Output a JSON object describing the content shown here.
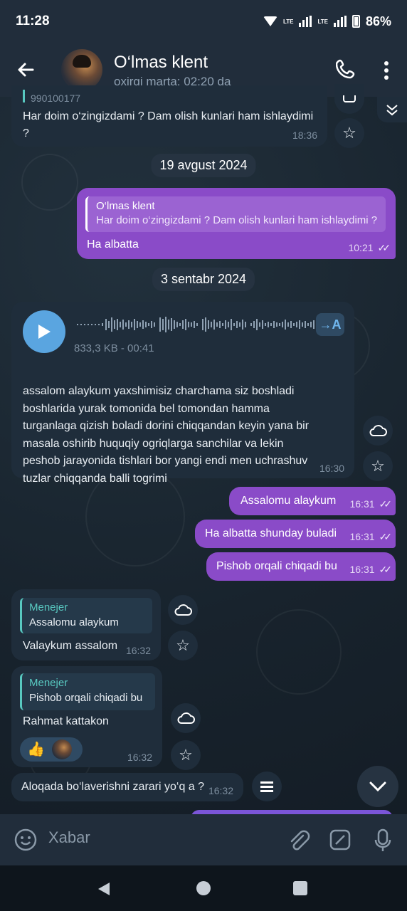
{
  "status": {
    "time": "11:28",
    "battery": "86%",
    "net1": "LTE",
    "net2": "LTE"
  },
  "header": {
    "contact_name": "O‘lmas klent",
    "last_seen": "oxirgi marta: 02:20 da"
  },
  "messages": {
    "m1": {
      "reply_top": "990100177",
      "text": "Har doim o‘zingizdami ? Dam olish kunlari ham ishlaydimi ?",
      "time": "18:36"
    },
    "date1": "19 avgust 2024",
    "m2": {
      "reply_name": "O‘lmas klent",
      "reply_text": "Har doim o‘zingizdami ? Dam olish kunlari ham ishlaydimi ?",
      "text": "Ha albatta",
      "time": "10:21"
    },
    "date2": "3 sentabr 2024",
    "m3": {
      "voice_meta": "833,3 KB - 00:41",
      "transcribe": "→A",
      "text": "assalom alaykum yaxshimisiz charchama siz boshladi boshlarida yurak tomonida bel tomondan hamma turganlaga qizish boladi dorini chiqqandan keyin yana bir masala oshirib huquqiy ogriqlarga sanchilar va lekin peshob jarayonida tishlari bor yangi endi men uchrashuv tuzlar chiqqanda balli togrimi",
      "time": "16:30"
    },
    "m4": {
      "text": "Assalomu alaykum",
      "time": "16:31"
    },
    "m5": {
      "text": "Ha albatta shunday buladi",
      "time": "16:31"
    },
    "m6": {
      "text": "Pishob orqali chiqadi bu",
      "time": "16:31"
    },
    "m7": {
      "reply_name": "Menejer",
      "reply_text": "Assalomu alaykum",
      "text": "Valaykum assalom",
      "time": "16:32"
    },
    "m8": {
      "reply_name": "Menejer",
      "reply_text": "Pishob orqali chiqadi bu",
      "text": "Rahmat kattakon",
      "reaction": "👍",
      "time": "16:32"
    },
    "m9": {
      "text": "Aloqada bo‘laverishni zarari yo‘q a ?",
      "time": "16:32"
    }
  },
  "input": {
    "placeholder": "Xabar"
  },
  "colors": {
    "header": "#212d3b",
    "outgoing": "#8a4bc8",
    "incoming": "#1f2d3b",
    "accent": "#58c8c0"
  },
  "icons": [
    "back-icon",
    "phone-icon",
    "more-icon",
    "scroll-up-icon",
    "cloud-icon",
    "star-icon",
    "play-icon",
    "menu-icon",
    "scroll-down-icon",
    "emoji-icon",
    "attach-icon",
    "sticker-icon",
    "mic-icon"
  ]
}
